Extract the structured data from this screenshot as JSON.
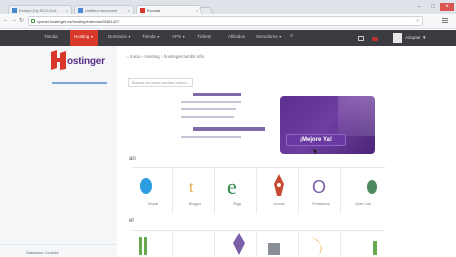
{
  "browser": {
    "tabs": [
      {
        "title": "Extract (H)-SCU-Gv4"
      },
      {
        "title": "Untitled document"
      },
      {
        "title": "Escoda"
      }
    ],
    "url": "cpanel.hostinger.es/hosting/index/aid/3461427"
  },
  "header": {
    "nav": [
      {
        "label": "Tienda"
      },
      {
        "label": "Hosting"
      },
      {
        "label": "Dominios"
      },
      {
        "label": "Tienda"
      },
      {
        "label": "VPS"
      },
      {
        "label": "Tickets"
      },
      {
        "label": "Afiliados"
      },
      {
        "label": "Servidores"
      }
    ],
    "user_label": "Adoptar"
  },
  "sidebar": {
    "logo_text": "ostinger",
    "footer_label": "Database Cookies"
  },
  "breadcrumb": {
    "home": "Inicio",
    "items": [
      "Hosting",
      "hostinger.tumblr.info"
    ]
  },
  "search": {
    "placeholder": "Buscar en cada nombre nuevo..."
  },
  "promo": {
    "button_label": "¡Mejore Ya!"
  },
  "sections": [
    {
      "title": "an"
    },
    {
      "title": "el"
    }
  ],
  "apps_row1": [
    {
      "label": "Drupal",
      "color": "#2b9de0"
    },
    {
      "label": "Blogger",
      "color": "#e8a332"
    },
    {
      "label": "Pligg",
      "color": "#2a8a4a"
    },
    {
      "label": "Joomla",
      "color": "#c54a30"
    },
    {
      "label": "Prestashop",
      "color": "#7a5fa8"
    },
    {
      "label": "Open Cart",
      "color": "#4f8a5e"
    }
  ]
}
